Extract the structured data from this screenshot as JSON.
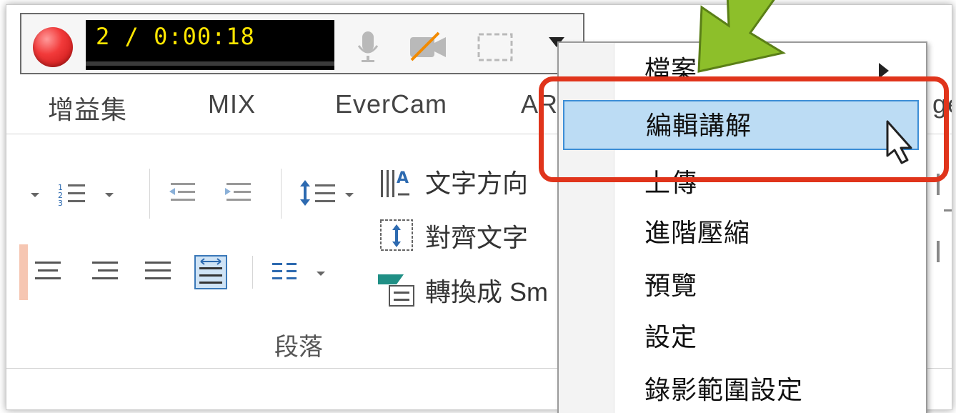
{
  "recorder": {
    "timer": "2 / 0:00:18",
    "icons": [
      "record-button",
      "microphone-icon",
      "camera-off-icon",
      "region-select-icon",
      "dropdown-arrow"
    ]
  },
  "tabs": [
    {
      "label": "增益集"
    },
    {
      "label": "MIX"
    },
    {
      "label": "EverCam"
    },
    {
      "label": "AR"
    }
  ],
  "right_fragment": "ge",
  "ribbon": {
    "text_direction": "文字方向",
    "align_text": "對齊文字",
    "convert_smartart": "轉換成 Sm",
    "group_label": "段落"
  },
  "menu": {
    "items": [
      {
        "label": "檔案",
        "has_submenu": true
      },
      {
        "label": "編輯講解",
        "highlighted": true
      },
      {
        "label": "上傳"
      },
      {
        "label": "進階壓縮"
      },
      {
        "label": "預覽"
      },
      {
        "label": "設定"
      },
      {
        "label": "錄影範圍設定"
      }
    ]
  },
  "colors": {
    "highlight_fill": "#bcdcf4",
    "highlight_border": "#3d8ed6",
    "callout_border": "#e0341b",
    "arrow_green": "#8dbf2a",
    "timer_text": "#ffe600"
  }
}
